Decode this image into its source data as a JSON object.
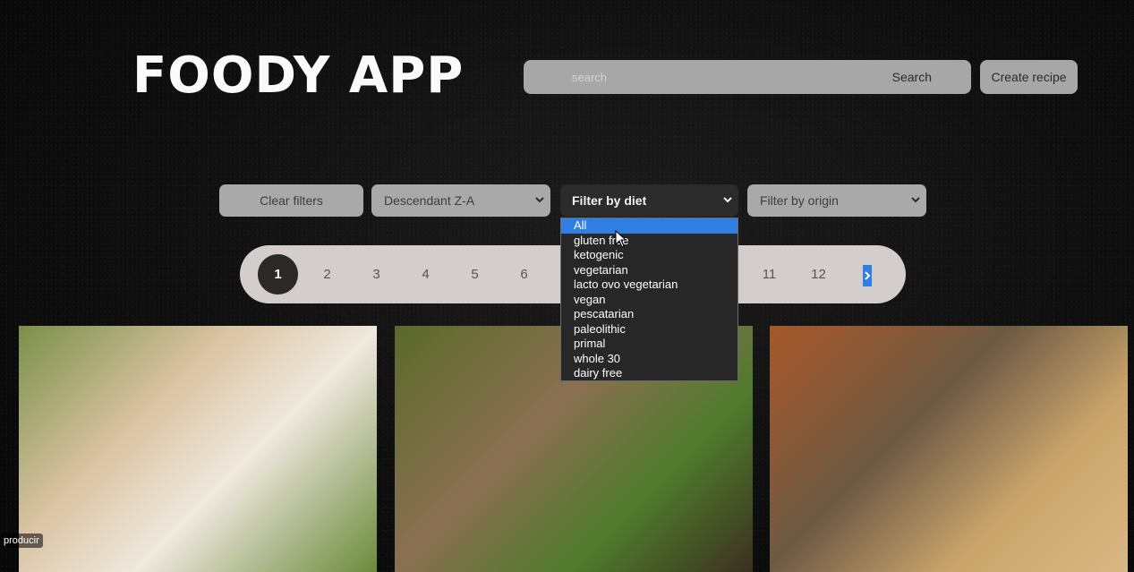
{
  "app": {
    "title": "FOODY APP"
  },
  "search": {
    "placeholder": "search",
    "button_label": "Search"
  },
  "header": {
    "create_label": "Create recipe"
  },
  "filters": {
    "clear_label": "Clear filters",
    "sort_value": "Descendant Z-A",
    "diet_value": "Filter by diet",
    "origin_value": "Filter by origin"
  },
  "diet_options": [
    "All",
    "gluten free",
    "ketogenic",
    "vegetarian",
    "lacto ovo vegetarian",
    "vegan",
    "pescatarian",
    "paleolithic",
    "primal",
    "whole 30",
    "dairy free"
  ],
  "diet_selected_index": 0,
  "pagination": {
    "pages": [
      "1",
      "2",
      "3",
      "4",
      "5",
      "6",
      "7",
      "8",
      "9",
      "10",
      "11",
      "12"
    ],
    "current": "1",
    "next_icon": "chevron-right-icon"
  },
  "recipes": [
    {
      "image": "dip-with-vegetables"
    },
    {
      "image": "salad-with-yogurt"
    },
    {
      "image": "pizza"
    }
  ],
  "video_overlay": {
    "text": "producir"
  },
  "colors": {
    "accent": "#2f7ee0",
    "control_bg": "#a9a9a9",
    "pager_bg": "#d3cdcd"
  }
}
